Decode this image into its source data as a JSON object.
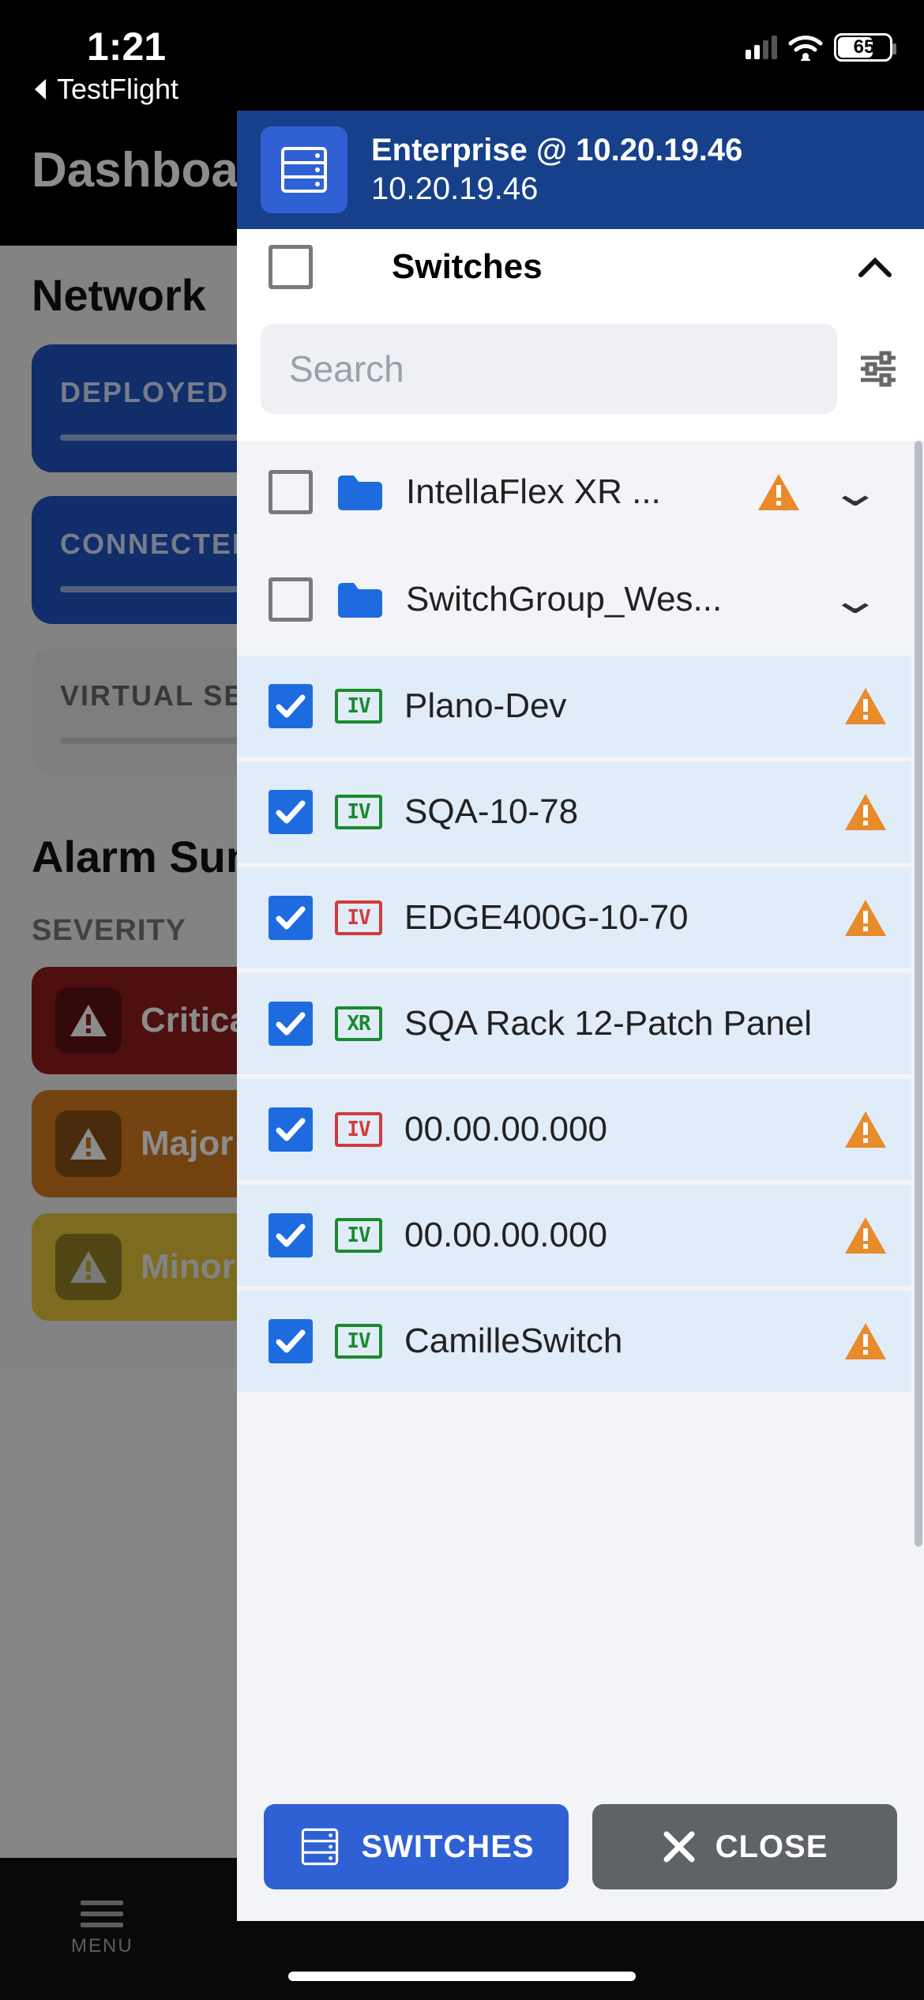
{
  "status": {
    "time": "1:21",
    "back_app": "TestFlight",
    "battery": "65"
  },
  "background": {
    "title": "Dashboard",
    "network_heading": "Network",
    "cards": {
      "deployed": "DEPLOYED",
      "connected": "CONNECTED",
      "virtual": "VIRTUAL SE"
    },
    "alarm_heading": "Alarm Summary",
    "severity_label": "SEVERITY",
    "alarms": {
      "critical": "Critical",
      "major": "Major",
      "minor": "Minor"
    },
    "menu_label": "MENU"
  },
  "panel": {
    "header": {
      "line1": "Enterprise @ 10.20.19.46",
      "line2": "10.20.19.46"
    },
    "select_all_label": "Switches",
    "search_placeholder": "Search",
    "items": [
      {
        "type": "group",
        "checked": false,
        "label": "IntellaFlex XR ...",
        "warn": true,
        "expandable": true
      },
      {
        "type": "group",
        "checked": false,
        "label": "SwitchGroup_Wes...",
        "warn": false,
        "expandable": true
      },
      {
        "type": "switch",
        "checked": true,
        "badge": "IV",
        "badge_color": "green",
        "label": "Plano-Dev",
        "warn": true
      },
      {
        "type": "switch",
        "checked": true,
        "badge": "IV",
        "badge_color": "green",
        "label": "SQA-10-78",
        "warn": true
      },
      {
        "type": "switch",
        "checked": true,
        "badge": "IV",
        "badge_color": "red",
        "label": "EDGE400G-10-70",
        "warn": true
      },
      {
        "type": "switch",
        "checked": true,
        "badge": "XR",
        "badge_color": "green",
        "label": "SQA Rack 12-Patch Panel",
        "warn": false
      },
      {
        "type": "switch",
        "checked": true,
        "badge": "IV",
        "badge_color": "red",
        "label": "00.00.00.000",
        "warn": true
      },
      {
        "type": "switch",
        "checked": true,
        "badge": "IV",
        "badge_color": "green",
        "label": "00.00.00.000",
        "warn": true
      },
      {
        "type": "switch",
        "checked": true,
        "badge": "IV",
        "badge_color": "green",
        "label": "CamilleSwitch",
        "warn": true
      }
    ],
    "footer": {
      "switches": "SWITCHES",
      "close": "CLOSE"
    }
  }
}
